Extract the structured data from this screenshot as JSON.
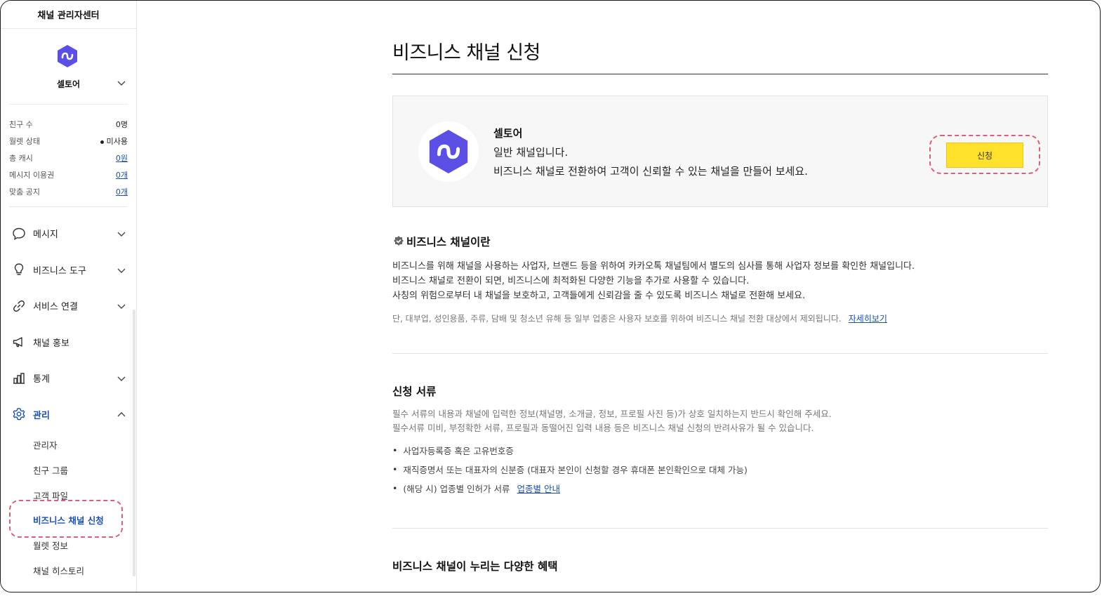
{
  "sidebar": {
    "title": "채널 관리자센터",
    "profile_name": "셀토어",
    "stats": [
      {
        "label": "친구 수",
        "value": "0명",
        "link": false,
        "dot": false
      },
      {
        "label": "월렛 상태",
        "value": "미사용",
        "link": false,
        "dot": true
      },
      {
        "label": "총 캐시",
        "value": "0원",
        "link": true,
        "dot": false
      },
      {
        "label": "메시지 이용권",
        "value": "0개",
        "link": true,
        "dot": false
      },
      {
        "label": "맞춤 공지",
        "value": "0개",
        "link": true,
        "dot": false
      }
    ],
    "menu": [
      {
        "label": "메시지",
        "icon": "speech-bubble-icon",
        "chevron": "down"
      },
      {
        "label": "비즈니스 도구",
        "icon": "lightbulb-icon",
        "chevron": "down"
      },
      {
        "label": "서비스 연결",
        "icon": "link-icon",
        "chevron": "down"
      },
      {
        "label": "채널 홍보",
        "icon": "megaphone-icon",
        "chevron": ""
      },
      {
        "label": "통계",
        "icon": "bar-chart-icon",
        "chevron": "down"
      },
      {
        "label": "관리",
        "icon": "gear-icon",
        "chevron": "up",
        "active": true
      }
    ],
    "submenu": [
      {
        "label": "관리자"
      },
      {
        "label": "친구 그룹"
      },
      {
        "label": "고객 파일"
      },
      {
        "label": "비즈니스 채널 신청",
        "active": true
      },
      {
        "label": "월렛 정보"
      },
      {
        "label": "채널 히스토리"
      }
    ]
  },
  "main": {
    "title": "비즈니스 채널 신청",
    "card": {
      "name": "셀토어",
      "line1": "일반 채널입니다.",
      "line2": "비즈니스 채널로 전환하여 고객이 신뢰할 수 있는 채널을 만들어 보세요.",
      "button": "신청"
    },
    "about": {
      "title": "비즈니스 채널이란",
      "lines": [
        "비즈니스를 위해 채널을 사용하는 사업자, 브랜드 등을 위하여 카카오톡 채널팀에서 별도의 심사를 통해 사업자 정보를 확인한 채널입니다.",
        "비즈니스 채널로 전환이 되면, 비즈니스에 최적화된 다양한 기능을 추가로 사용할 수 있습니다.",
        "사칭의 위험으로부터 내 채널을 보호하고, 고객들에게 신뢰감을 줄 수 있도록 비즈니스 채널로 전환해 보세요."
      ],
      "note": "단, 대부업, 성인용품, 주류, 담배 및 청소년 유해 등 일부 업종은 사용자 보호를 위하여 비즈니스 채널 전환 대상에서 제외됩니다.",
      "note_link": "자세히보기"
    },
    "docs": {
      "title": "신청 서류",
      "desc1": "필수 서류의 내용과 채널에 입력한 정보(채널명, 소개글, 정보, 프로필 사진 등)가 상호 일치하는지 반드시 확인해 주세요.",
      "desc2": "필수서류 미비, 부정확한 서류, 프로필과 동떨어진 입력 내용 등은 비즈니스 채널 신청의 반려사유가 될 수 있습니다.",
      "items": [
        "사업자등록증 혹은 고유번호증",
        "재직증명서 또는 대표자의 신분증 (대표자 본인이 신청할 경우 휴대폰 본인확인으로 대체 가능)",
        "(해당 시) 업종별 인허가 서류"
      ],
      "item_link": "업종별 안내"
    },
    "benefits": {
      "title": "비즈니스 채널이 누리는 다양한 혜택"
    }
  },
  "colors": {
    "accent_blue": "#1a4fb3",
    "button_yellow": "#ffe12b",
    "logo_purple": "#5b4fe6",
    "highlight_pink": "#d9607a"
  }
}
